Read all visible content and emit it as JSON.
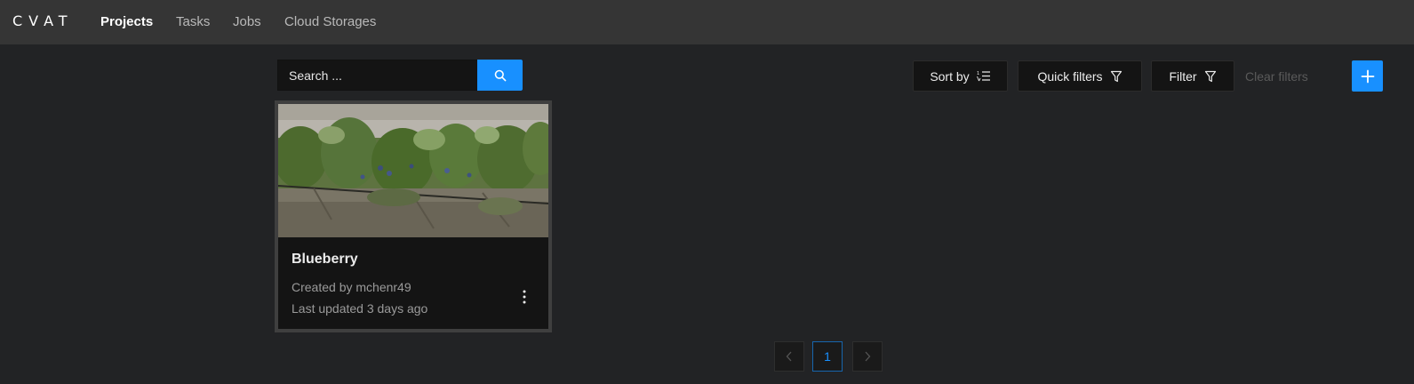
{
  "app": {
    "logo": "CVAT"
  },
  "nav": {
    "projects": "Projects",
    "tasks": "Tasks",
    "jobs": "Jobs",
    "cloud_storages": "Cloud Storages"
  },
  "search": {
    "placeholder": "Search ..."
  },
  "toolbar": {
    "sort_by": "Sort by",
    "quick_filters": "Quick filters",
    "filter": "Filter",
    "clear_filters": "Clear filters"
  },
  "projects": [
    {
      "name": "Blueberry",
      "created_by": "Created by mchenr49",
      "last_updated": "Last updated 3 days ago"
    }
  ],
  "pagination": {
    "current_page": "1"
  },
  "colors": {
    "accent": "#1890ff",
    "header_bg": "#353535",
    "page_bg": "#222325",
    "card_bg": "#141414"
  },
  "icons": {
    "search": "search-icon",
    "sort": "sort-icon",
    "filter": "filter-icon",
    "add": "plus-icon",
    "menu": "more-vertical-icon",
    "prev": "chevron-left-icon",
    "next": "chevron-right-icon"
  }
}
